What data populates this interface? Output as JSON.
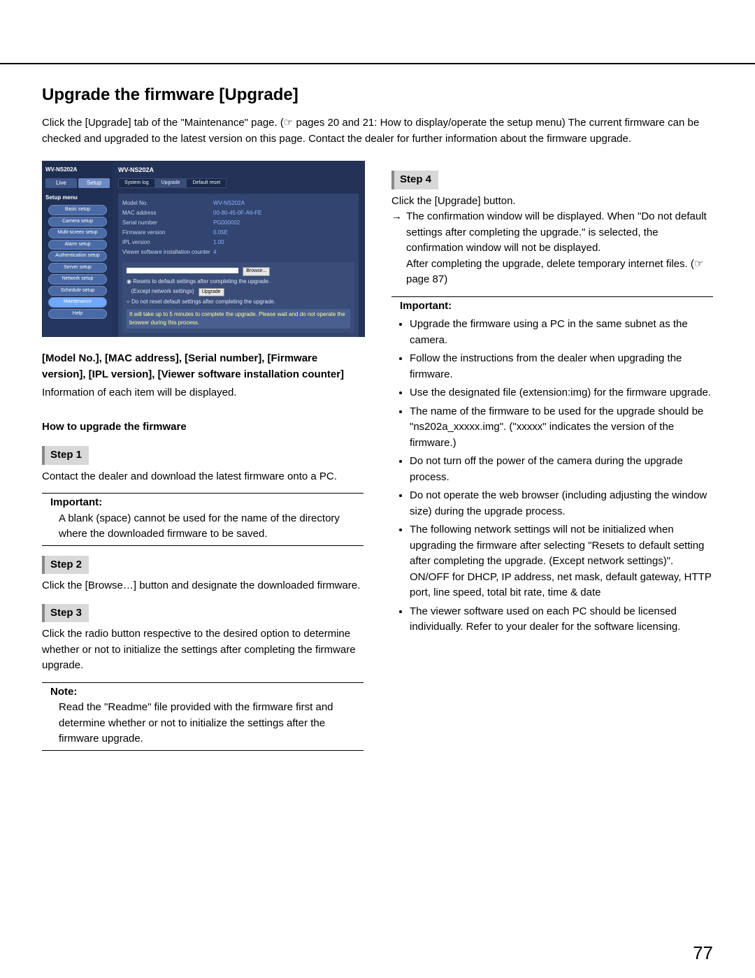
{
  "page_number": "77",
  "title": "Upgrade the firmware [Upgrade]",
  "intro_parts": {
    "a": "Click the [Upgrade] tab of the \"Maintenance\" page. (",
    "ref": "☞",
    "b": " pages 20 and 21: How to display/operate the setup menu) The current firmware can be checked and upgraded to the latest version on this page. Contact the dealer for further information about the firmware upgrade."
  },
  "screenshot": {
    "brand": "WV-NS202A",
    "title": "WV-NS202A",
    "top_tabs": {
      "live": "Live",
      "setup": "Setup"
    },
    "menu_header": "Setup menu",
    "side_items": [
      "Basic setup",
      "Camera setup",
      "Multi-screen setup",
      "Alarm setup",
      "Authentication setup",
      "Server setup",
      "Network setup",
      "Schedule setup",
      "Maintenance",
      "Help"
    ],
    "sub_tabs": [
      "System log",
      "Upgrade",
      "Default reset"
    ],
    "fields": [
      {
        "k": "Model No.",
        "v": "WV-NS202A"
      },
      {
        "k": "MAC address",
        "v": "00-80-45-0F-A6-FE"
      },
      {
        "k": "Serial number",
        "v": "PG000002"
      },
      {
        "k": "Firmware version",
        "v": "0.05E"
      },
      {
        "k": "IPL version",
        "v": "1.00"
      },
      {
        "k": "Viewer software installation counter",
        "v": "4"
      }
    ],
    "browse_btn": "Browse...",
    "radio1": "Resets to default settings after completing the upgrade.",
    "radio2": "(Except network settings)",
    "radio3": "Do not reset default settings after completing the upgrade.",
    "upgrade_btn": "Upgrade",
    "warn_text": "It will take up to 5 minutes to complete the upgrade. Please wait and do not operate the browser during this process."
  },
  "left": {
    "fields_heading": "[Model No.], [MAC address], [Serial number], [Firmware version], [IPL version], [Viewer software installation counter]",
    "fields_text": "Information of each item will be displayed.",
    "howto": "How to upgrade the firmware",
    "step1_label": "Step 1",
    "step1_text": "Contact the dealer and download the latest firmware onto a PC.",
    "imp1_label": "Important:",
    "imp1_text": "A blank (space) cannot be used for the name of the directory where the downloaded firmware to be saved.",
    "step2_label": "Step 2",
    "step2_text": "Click the [Browse…] button and designate the downloaded firmware.",
    "step3_label": "Step 3",
    "step3_text": "Click the radio button respective to the desired option to determine whether or not to initialize the settings after completing the firmware upgrade.",
    "note_label": "Note:",
    "note_text": "Read the \"Readme\" file provided with the firmware first and determine whether or not to initialize the settings after the firmware upgrade."
  },
  "right": {
    "step4_label": "Step 4",
    "step4_a": "Click the [Upgrade] button.",
    "step4_b": "The confirmation window will be displayed. When \"Do not default settings after completing the upgrade.\" is selected, the confirmation window will not be displayed.",
    "step4_c1": "After completing the upgrade, delete temporary internet files. (",
    "step4_ref": "☞",
    "step4_c2": " page 87)",
    "imp_label": "Important:",
    "bullets": [
      "Upgrade the firmware using a PC in the same subnet as the camera.",
      "Follow the instructions from the dealer when upgrading the firmware.",
      "Use the designated file (extension:img) for the firmware upgrade.",
      "The name of the firmware to be used for the upgrade should be \"ns202a_xxxxx.img\". (\"xxxxx\" indicates the version of the firmware.)",
      "Do not turn off the power of the camera during the upgrade process.",
      "Do not operate the web browser (including adjusting the window size) during the upgrade process.",
      "The following network settings will not be initialized when upgrading the firmware after selecting \"Resets to default setting after completing the upgrade. (Except network settings)\".\nON/OFF for DHCP, IP address, net mask, default gateway, HTTP port, line speed, total bit rate, time & date",
      "The viewer software used on each PC should be licensed individually. Refer to your dealer for the software licensing."
    ]
  }
}
